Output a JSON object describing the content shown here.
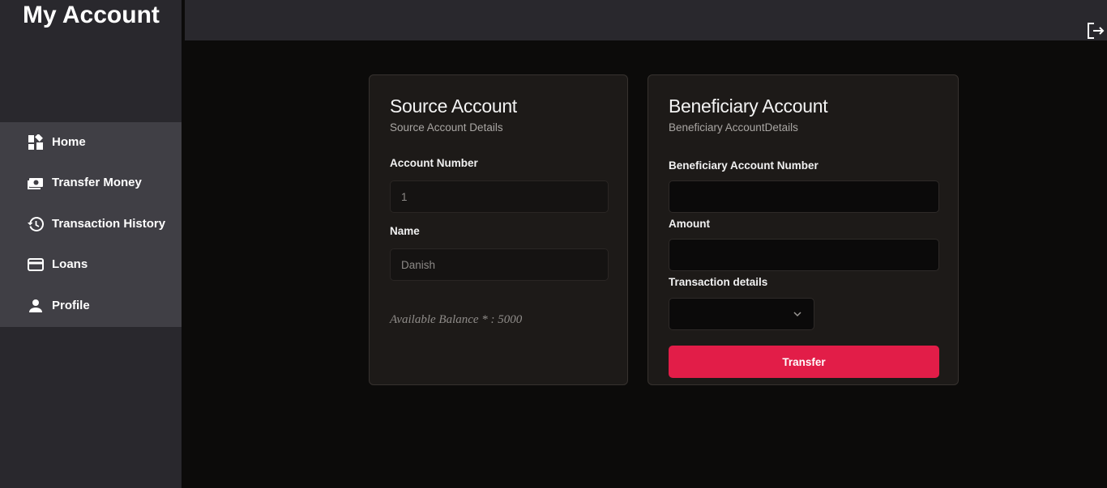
{
  "sidebar": {
    "brand": "My Account",
    "items": [
      {
        "label": "Home",
        "icon": "dashboard-icon"
      },
      {
        "label": "Transfer Money",
        "icon": "money-icon"
      },
      {
        "label": "Transaction History",
        "icon": "history-icon"
      },
      {
        "label": "Loans",
        "icon": "credit-card-icon"
      },
      {
        "label": "Profile",
        "icon": "person-icon"
      }
    ]
  },
  "topbar": {
    "logout_icon": "logout-icon"
  },
  "source": {
    "title": "Source Account",
    "subtitle": "Source Account Details",
    "account_number_label": "Account Number",
    "account_number_value": "1",
    "name_label": "Name",
    "name_value": "Danish",
    "balance_text": "Available Balance * : 5000"
  },
  "beneficiary": {
    "title": "Beneficiary Account",
    "subtitle": "Beneficiary AccountDetails",
    "account_number_label": "Beneficiary Account Number",
    "account_number_value": "",
    "amount_label": "Amount",
    "amount_value": "",
    "details_label": "Transaction details",
    "details_value": "",
    "transfer_label": "Transfer"
  },
  "colors": {
    "accent": "#e21d48",
    "sidebar_bg": "#29282d",
    "nav_bg": "#403f45",
    "card_bg": "#1d1a18",
    "page_bg": "#0c0b0a"
  }
}
